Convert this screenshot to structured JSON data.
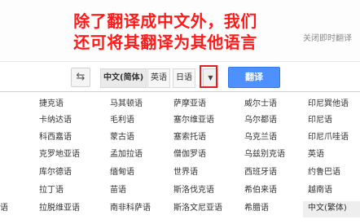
{
  "annotation": {
    "line1": "除了翻译成中文外，我们",
    "line2": "还可将其翻译为其他语言"
  },
  "header": {
    "close_instant_label": "关闭即时翻译"
  },
  "toolbar": {
    "swap_icon": "swap-arrows-icon",
    "target_languages": [
      "中文(简体)",
      "英语",
      "日语"
    ],
    "dropdown_icon": "chevron-down-icon",
    "translate_label": "翻译"
  },
  "language_menu": {
    "columns": [
      [
        "",
        "",
        "",
        "",
        "",
        "",
        "语",
        ""
      ],
      [
        "捷克语",
        "卡纳达语",
        "科西嘉语",
        "克罗地亚语",
        "库尔德语",
        "拉丁语",
        "拉脱维亚语",
        ""
      ],
      [
        "马其顿语",
        "毛利语",
        "蒙古语",
        "孟加拉语",
        "缅甸语",
        "苗语",
        "南非科萨语",
        ""
      ],
      [
        "萨摩亚语",
        "塞尔维亚语",
        "塞索托语",
        "僧伽罗语",
        "世界语",
        "斯洛伐克语",
        "斯洛文尼亚语",
        ""
      ],
      [
        "威尔士语",
        "乌尔都语",
        "乌克兰语",
        "乌兹别克语",
        "西班牙语",
        "希伯来语",
        "希腊语",
        ""
      ],
      [
        "印尼巽他语",
        "印尼语",
        "印尼爪哇语",
        "英语",
        "约鲁巴语",
        "越南语",
        "中文(繁体)",
        ""
      ]
    ],
    "selected": "中文(繁体)"
  },
  "colors": {
    "annotation_red": "#ff1a1a",
    "translate_blue": "#4d90fe"
  }
}
